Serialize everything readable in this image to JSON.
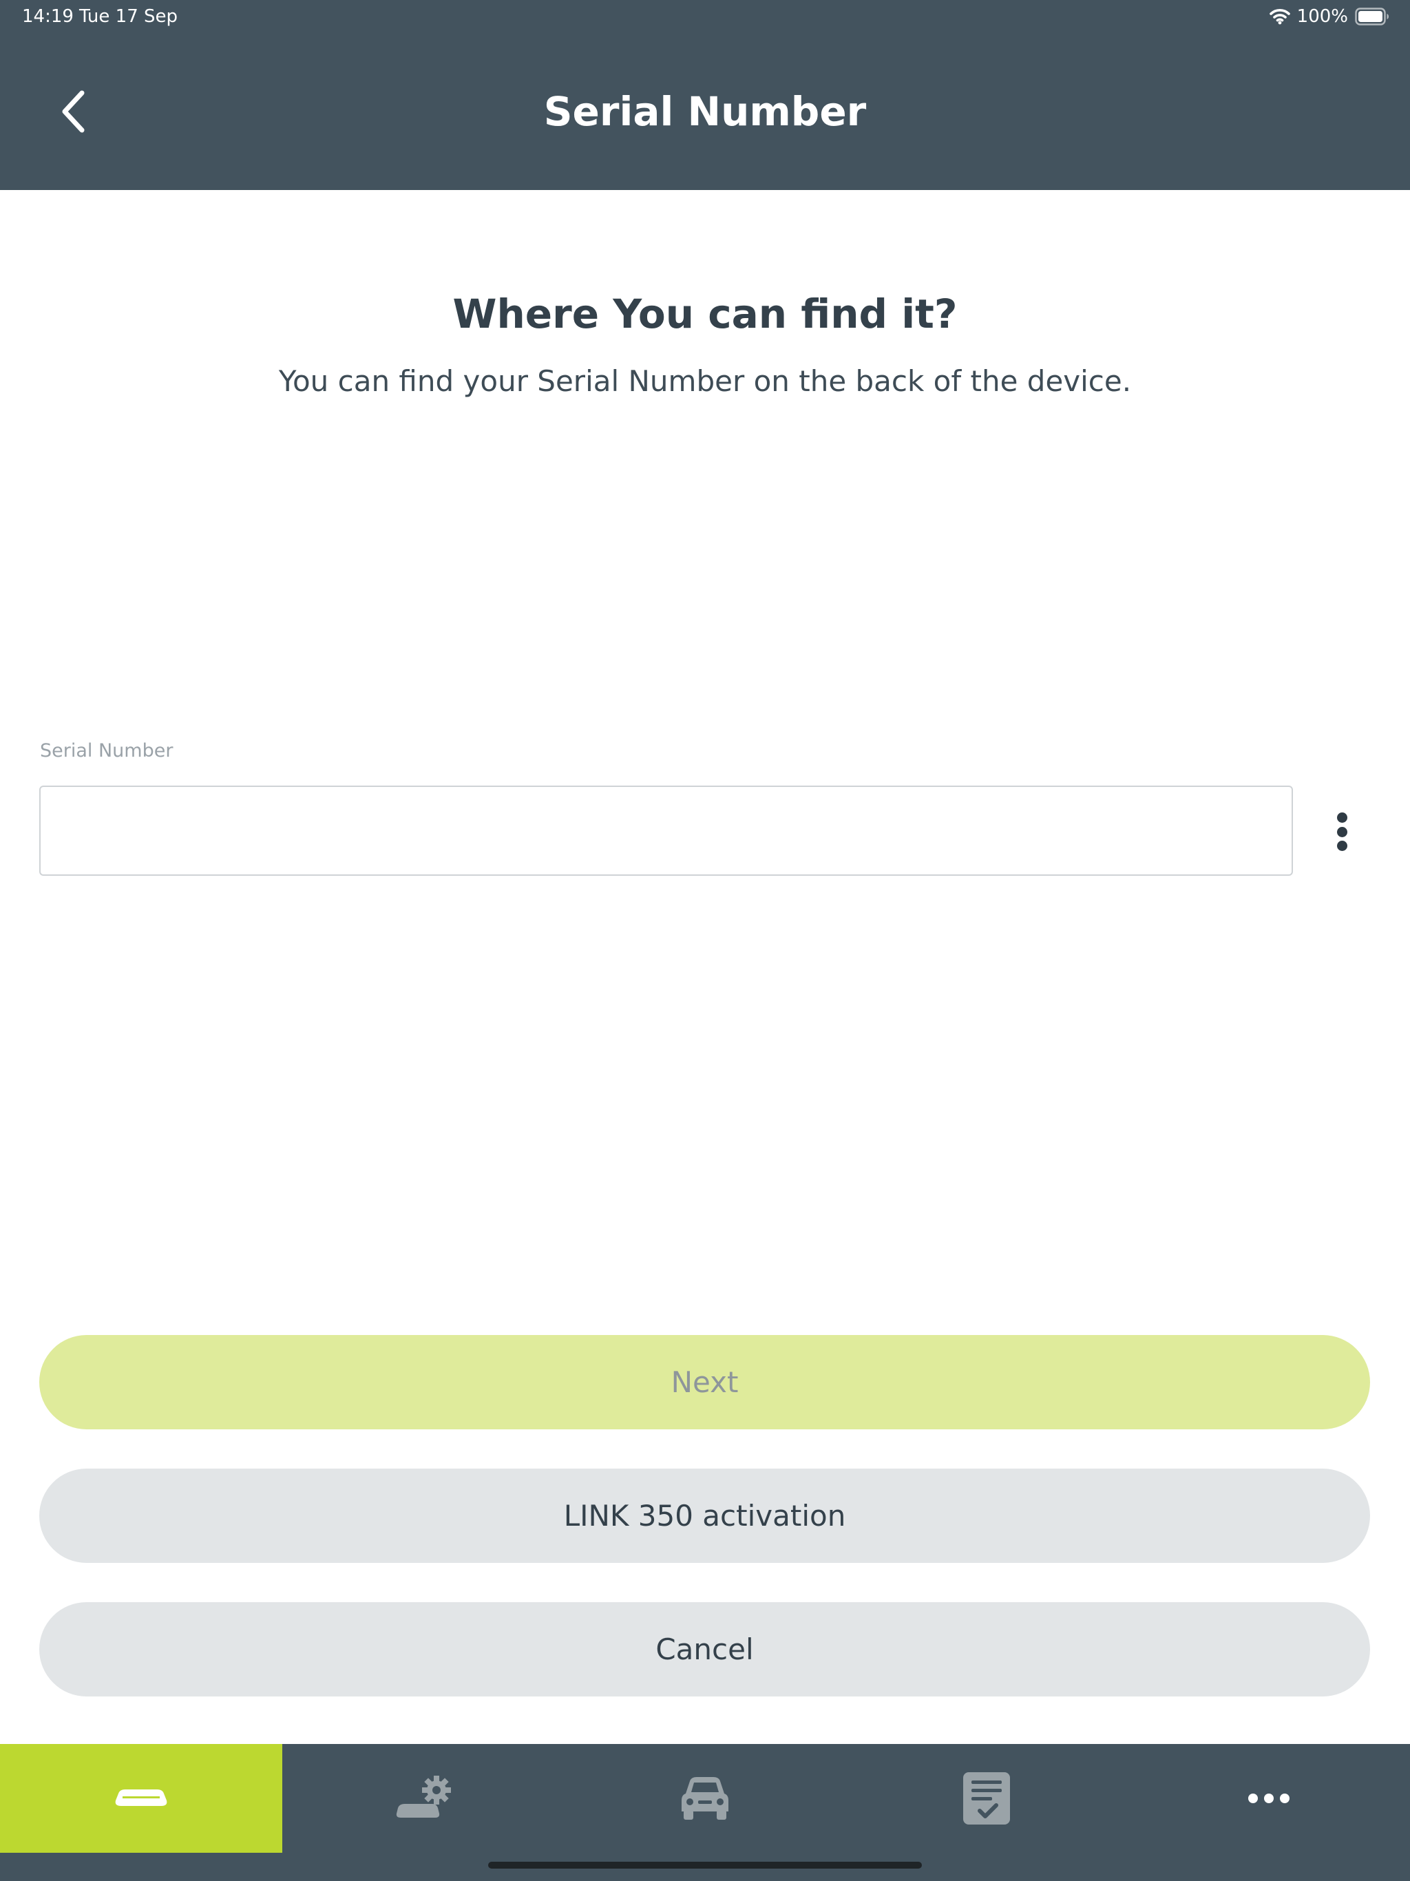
{
  "status_bar": {
    "time": "14:19",
    "date": "Tue 17 Sep",
    "battery": "100%",
    "icons": [
      "wifi-icon",
      "battery-icon"
    ]
  },
  "header": {
    "title": "Serial Number",
    "back_icon": "chevron-left-icon"
  },
  "info": {
    "heading": "Where You can find it?",
    "description": "You can find your Serial Number on the back of the device."
  },
  "serial_field": {
    "label": "Serial Number",
    "value": "",
    "placeholder": "",
    "menu_icon": "more-vertical-icon"
  },
  "actions": {
    "next_label": "Next",
    "link_label": "LINK 350 activation",
    "cancel_label": "Cancel"
  },
  "tab_bar": {
    "tabs": [
      {
        "icon": "device-icon",
        "active": true
      },
      {
        "icon": "device-settings-icon",
        "active": false
      },
      {
        "icon": "car-icon",
        "active": false
      },
      {
        "icon": "checklist-icon",
        "active": false
      },
      {
        "icon": "more-horizontal-icon",
        "active": false
      }
    ]
  },
  "colors": {
    "header_bg": "#43535e",
    "accent": "#bcd830",
    "next_disabled_bg": "#dfeb9b",
    "secondary_button_bg": "#e2e5e7",
    "text_dark": "#34414b",
    "tab_icon_inactive": "#9aa3a8"
  }
}
